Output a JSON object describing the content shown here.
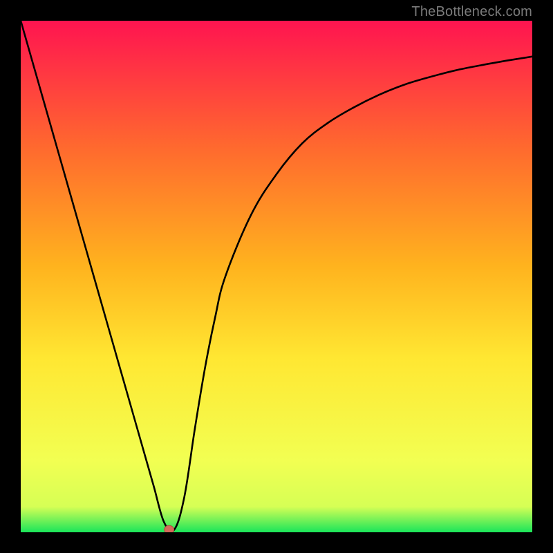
{
  "watermark": "TheBottleneck.com",
  "colors": {
    "frame_bg": "#000000",
    "gradient_top": "#ff1450",
    "gradient_mid1": "#ff6a2e",
    "gradient_mid2": "#ffb31e",
    "gradient_mid3": "#ffe732",
    "gradient_mid4": "#f2ff52",
    "gradient_bottom": "#1ae55a",
    "curve": "#000000",
    "marker_fill": "#d46a5a",
    "marker_stroke": "#b44c3d"
  },
  "chart_data": {
    "type": "line",
    "title": "",
    "xlabel": "",
    "ylabel": "",
    "x": [
      0.0,
      0.02,
      0.04,
      0.06,
      0.08,
      0.1,
      0.12,
      0.14,
      0.16,
      0.18,
      0.2,
      0.22,
      0.24,
      0.26,
      0.28,
      0.3,
      0.32,
      0.34,
      0.36,
      0.38,
      0.4,
      0.45,
      0.5,
      0.55,
      0.6,
      0.65,
      0.7,
      0.75,
      0.8,
      0.85,
      0.9,
      0.95,
      1.0
    ],
    "values": [
      1.0,
      0.93,
      0.86,
      0.79,
      0.72,
      0.65,
      0.58,
      0.51,
      0.44,
      0.37,
      0.3,
      0.23,
      0.16,
      0.09,
      0.02,
      0.005,
      0.07,
      0.2,
      0.32,
      0.42,
      0.5,
      0.62,
      0.7,
      0.76,
      0.8,
      0.83,
      0.855,
      0.875,
      0.89,
      0.903,
      0.913,
      0.922,
      0.93
    ],
    "xlim": [
      0,
      1
    ],
    "ylim": [
      0,
      1
    ],
    "marker": {
      "x": 0.29,
      "y": 0.005
    },
    "notes": "V-shaped bottleneck curve; minimum near x≈0.29. Left branch steep linear descent from top-left; right branch concave rising toward ~0.93 at x=1. Background vertical gradient red→orange→yellow→green."
  }
}
